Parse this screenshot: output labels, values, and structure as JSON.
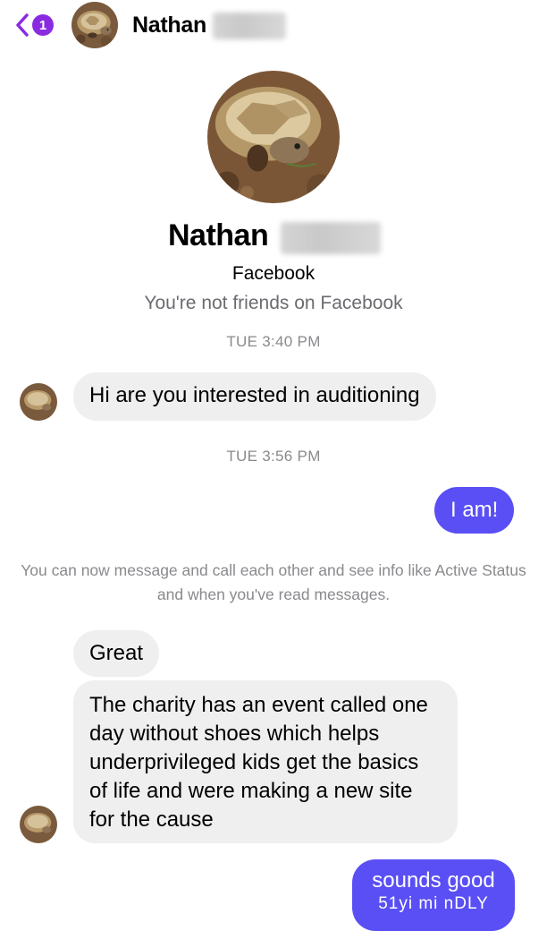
{
  "header": {
    "back_count": "1",
    "contact_name": "Nathan"
  },
  "profile": {
    "name": "Nathan",
    "platform": "Facebook",
    "friend_status": "You're not friends on Facebook"
  },
  "conversation": {
    "timestamp_1": "TUE 3:40 PM",
    "message_1": "Hi are you interested in auditioning",
    "timestamp_2": "TUE 3:56 PM",
    "message_2": "I am!",
    "system_note": "You can now message and call each other and see info like Active Status and when you've read messages.",
    "message_3": "Great",
    "message_4": "The charity has an event called one day without shoes which helps underprivileged kids get the basics of life and were making a new site for the cause",
    "message_5": "sounds good",
    "watermark": "51yi mi nDLY"
  },
  "colors": {
    "accent_purple": "#8a2be2",
    "outgoing_bubble": "#5a4ff4",
    "incoming_bubble": "#efefef",
    "muted_text": "#8a8a8e"
  }
}
